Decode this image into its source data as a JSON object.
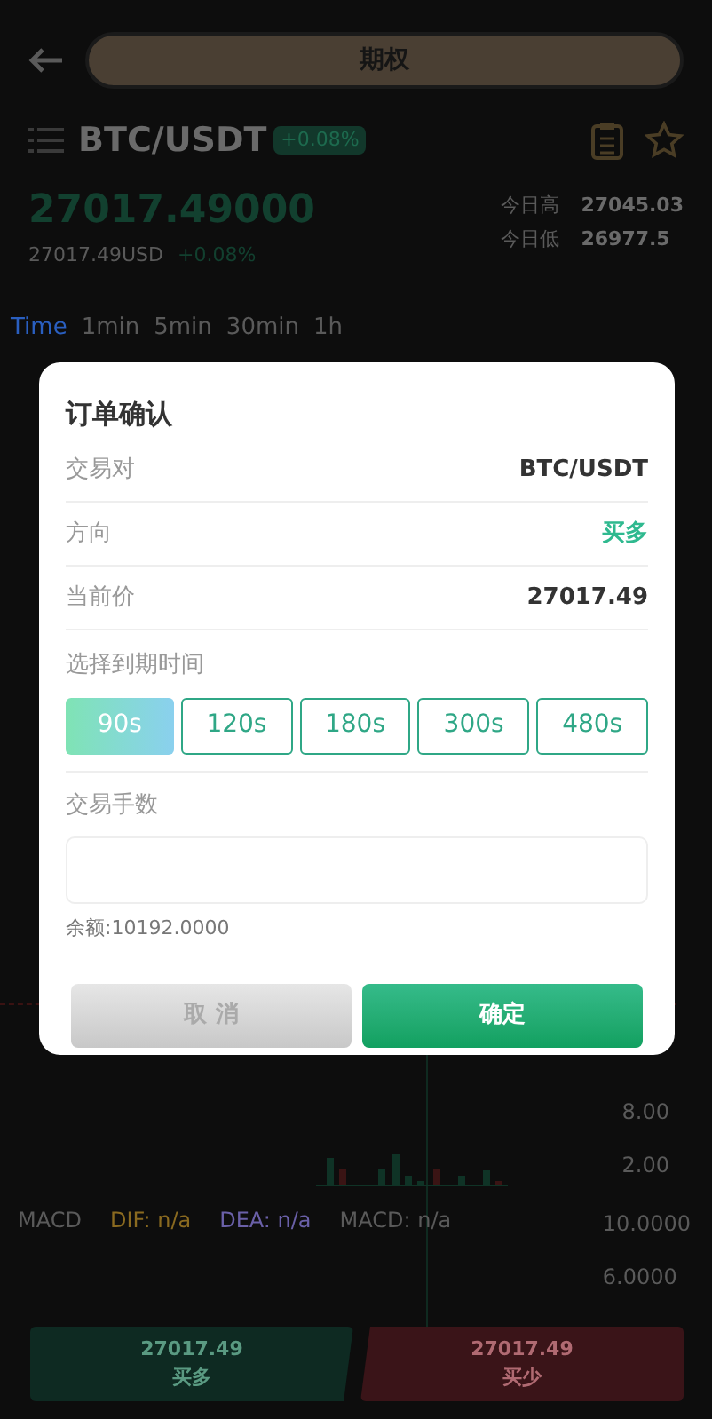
{
  "header": {
    "title": "期权"
  },
  "pair": {
    "symbol": "BTC/USDT",
    "change": "+0.08%"
  },
  "price": {
    "last": "27017.49000",
    "usd": "27017.49USD",
    "change": "+0.08%"
  },
  "stats": [
    {
      "label": "今日高",
      "value": "27045.03"
    },
    {
      "label": "今日低",
      "value": "26977.5"
    }
  ],
  "timeframes": [
    {
      "label": "Time",
      "selected": true
    },
    {
      "label": "1min",
      "selected": false
    },
    {
      "label": "5min",
      "selected": false
    },
    {
      "label": "30min",
      "selected": false
    },
    {
      "label": "1h",
      "selected": false
    }
  ],
  "chart": {
    "volume_axis": [
      "8.00",
      "2.00"
    ],
    "macd_legend": [
      {
        "label": "MACD",
        "color": "#5a5a5a"
      },
      {
        "label": "DIF: n/a",
        "color": "#8a6a20"
      },
      {
        "label": "DEA: n/a",
        "color": "#6a60a8"
      },
      {
        "label": "MACD: n/a",
        "color": "#5a5a5a"
      }
    ],
    "macd_axis": [
      "10.0000",
      "6.0000"
    ]
  },
  "dialog": {
    "title": "订单确认",
    "rows": [
      {
        "label": "交易对",
        "value": "BTC/USDT",
        "kind": "plain"
      },
      {
        "label": "方向",
        "value": "买多",
        "kind": "direction"
      },
      {
        "label": "当前价",
        "value": "27017.49",
        "kind": "plain"
      }
    ],
    "expiry_label": "选择到期时间",
    "expiry_options": [
      {
        "label": "90s",
        "selected": true
      },
      {
        "label": "120s",
        "selected": false
      },
      {
        "label": "180s",
        "selected": false
      },
      {
        "label": "300s",
        "selected": false
      },
      {
        "label": "480s",
        "selected": false
      }
    ],
    "amount_label": "交易手数",
    "balance": "余额:10192.0000",
    "buttons": [
      {
        "label": "取 消",
        "kind": "cancel"
      },
      {
        "label": "确定",
        "kind": "confirm"
      }
    ]
  },
  "trade_buttons": [
    {
      "price": "27017.49",
      "label": "买多",
      "kind": "long"
    },
    {
      "price": "27017.49",
      "label": "买少",
      "kind": "short"
    }
  ]
}
